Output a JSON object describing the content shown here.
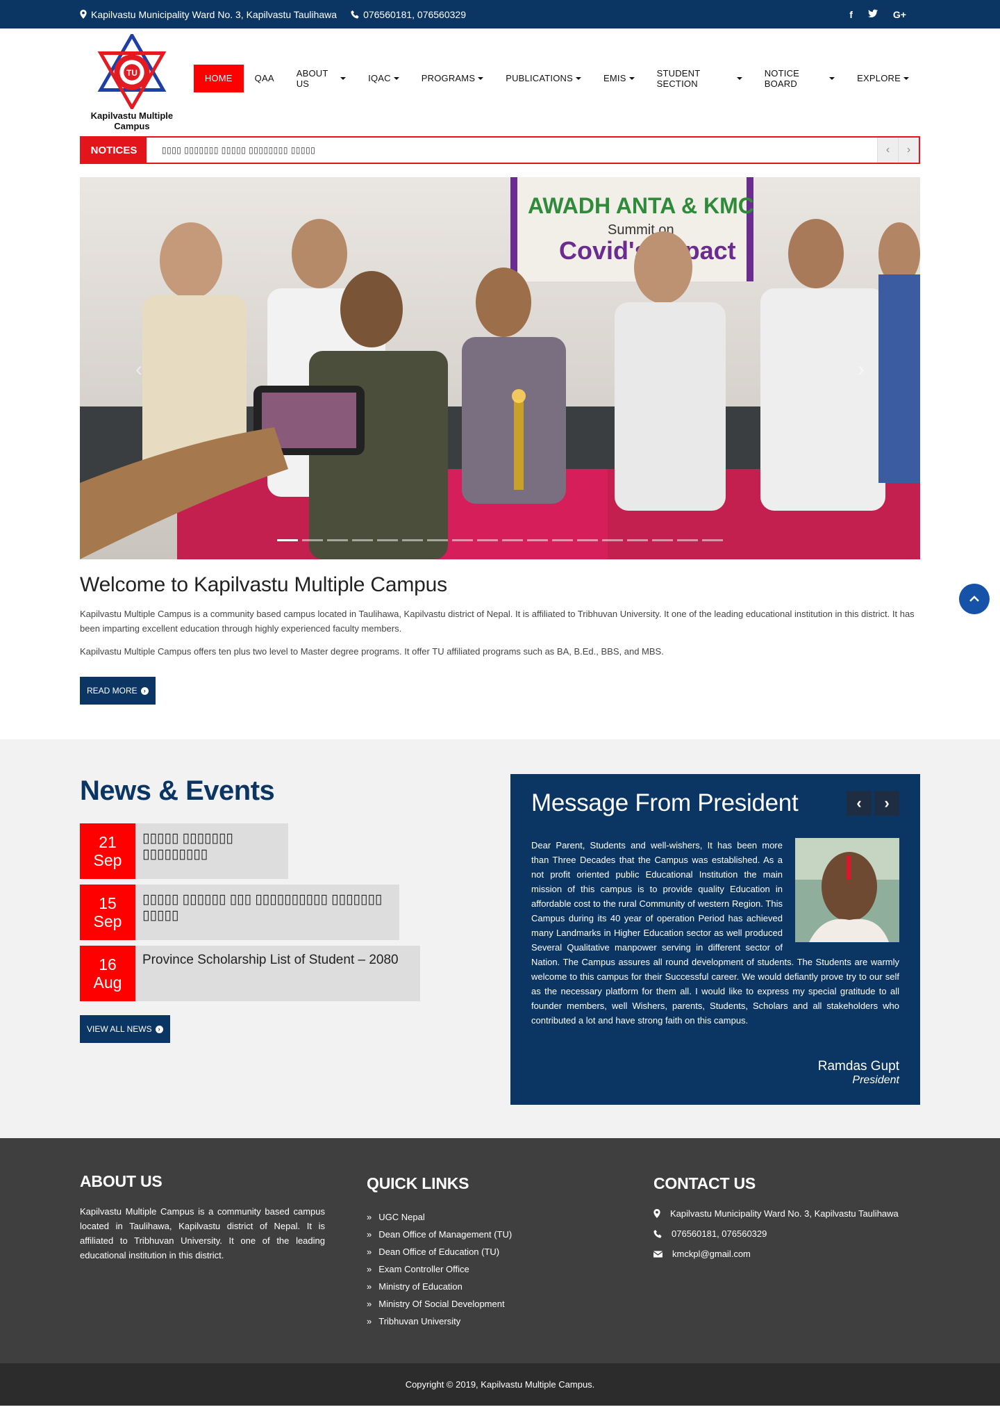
{
  "topbar": {
    "address": "Kapilvastu Municipality Ward No. 3, Kapilvastu Taulihawa",
    "phone": "076560181, 076560329",
    "social": [
      "f",
      "t",
      "G+"
    ]
  },
  "logo": {
    "name": "Kapilvastu Multiple Campus"
  },
  "nav": {
    "items": [
      {
        "label": "HOME",
        "active": true
      },
      {
        "label": "QAA"
      },
      {
        "label": "ABOUT US",
        "dropdown": true
      },
      {
        "label": "IQAC",
        "dropdown": true
      },
      {
        "label": "PROGRAMS",
        "dropdown": true
      },
      {
        "label": "PUBLICATIONS",
        "dropdown": true
      },
      {
        "label": "EMIS",
        "dropdown": true
      },
      {
        "label": "STUDENT SECTION",
        "dropdown": true
      },
      {
        "label": "NOTICE BOARD",
        "dropdown": true
      },
      {
        "label": "EXPLORE",
        "dropdown": true
      }
    ]
  },
  "notices": {
    "label": "NOTICES",
    "ticker": "▯▯▯▯ ▯▯▯▯▯▯▯ ▯▯▯▯▯ ▯▯▯▯▯▯▯▯ ▯▯▯▯▯",
    "prev": "‹",
    "next": "›"
  },
  "slider": {
    "banner_text": "AWADH ANTA & KMC",
    "banner_sub": "Summit on",
    "banner_sub2": "Covid's Impact",
    "slide_count": 18,
    "active_slide": 0
  },
  "welcome": {
    "title": "Welcome to Kapilvastu Multiple Campus",
    "para1": "Kapilvastu Multiple Campus is a community based campus located in Taulihawa, Kapilvastu district of Nepal. It is affiliated to Tribhuvan University. It one of the leading educational institution in this district. It has been imparting excellent education through highly experienced faculty members.",
    "para2": "Kapilvastu Multiple Campus offers ten plus two level to Master degree programs. It offer TU affiliated programs such as BA, B.Ed., BBS, and MBS.",
    "read_more": "READ MORE"
  },
  "news": {
    "title": "News & Events",
    "items": [
      {
        "day": "21",
        "month": "Sep",
        "title": "▯▯▯▯▯ ▯▯▯▯▯▯▯ ▯▯▯▯▯▯▯▯▯"
      },
      {
        "day": "15",
        "month": "Sep",
        "title": "▯▯▯▯▯ ▯▯▯▯▯▯ ▯▯▯ ▯▯▯▯▯▯▯▯▯▯ ▯▯▯▯▯▯▯ ▯▯▯▯▯"
      },
      {
        "day": "16",
        "month": "Aug",
        "title": "Province Scholarship List of Student – 2080"
      }
    ],
    "view_all": "VIEW ALL NEWS"
  },
  "president": {
    "title": "Message From President",
    "message": "Dear Parent, Students and well-wishers, It has been more than Three Decades that the Campus was established. As a not profit oriented public Educational Institution the main mission of this campus is to provide quality Education in affordable cost to the rural Community of western Region. This Campus during its 40 year of operation Period has achieved many Landmarks in Higher Education sector as well produced Several Qualitative manpower serving in different sector of Nation. The Campus assures all round development of students. The Students are warmly welcome to this campus for their Successful career. We would defiantly prove try to our self as the necessary platform for them all. I would like to express my special gratitude to all founder members, well Wishers, parents, Students, Scholars and all stakeholders who contributed a lot and have strong faith on this campus.",
    "name": "Ramdas Gupt",
    "role": "President"
  },
  "footer": {
    "about_title": "ABOUT US",
    "about_text": "Kapilvastu Multiple Campus is a community based campus located in Taulihawa, Kapilvastu district of Nepal. It is affiliated to Tribhuvan University. It one of the leading educational institution in this district.",
    "links_title": "QUICK LINKS",
    "links": [
      "UGC Nepal",
      "Dean Office of Management (TU)",
      "Dean Office of Education (TU)",
      "Exam Controller Office",
      "Ministry of Education",
      "Ministry Of Social Development",
      "Tribhuvan University"
    ],
    "contact_title": "CONTACT US",
    "contact_address": "Kapilvastu Municipality Ward No. 3, Kapilvastu Taulihawa",
    "contact_phone": "076560181, 076560329",
    "contact_email": "kmckpl@gmail.com",
    "copyright": "Copyright © 2019, Kapilvastu Multiple Campus."
  },
  "colors": {
    "primary": "#0b3563",
    "accent": "#ff0000",
    "footer": "#3f3f3f",
    "copyright_bar": "#2c2c2c"
  }
}
